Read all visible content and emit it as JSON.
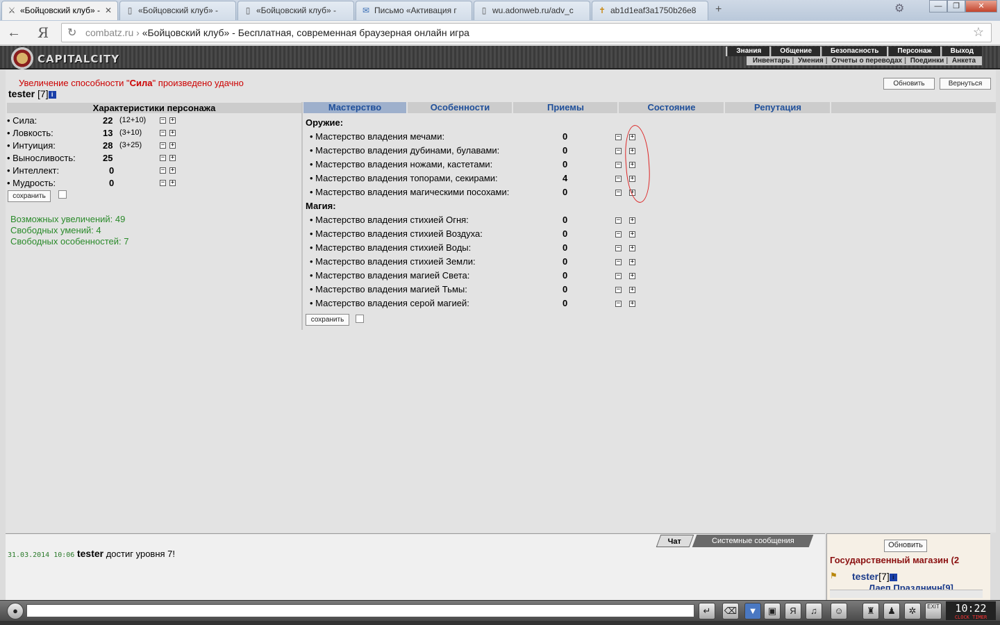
{
  "browser": {
    "tabs": [
      {
        "title": "«Бойцовский клуб» -",
        "icon": "crossed-swords-icon",
        "active": true
      },
      {
        "title": "«Бойцовский клуб» -",
        "icon": "page-icon"
      },
      {
        "title": "«Бойцовский клуб» -",
        "icon": "page-icon"
      },
      {
        "title": "Письмо «Активация г",
        "icon": "mail-icon"
      },
      {
        "title": "wu.adonweb.ru/adv_c",
        "icon": "page-icon"
      },
      {
        "title": "ab1d1eaf3a1750b26e8",
        "icon": "cross-icon"
      }
    ],
    "new_tab": "+",
    "window_buttons": {
      "minimize": "—",
      "maximize": "❐",
      "close": "✕"
    },
    "url_host": "combatz.ru",
    "url_sep": "›",
    "url_title": "«Бойцовский клуб» - Бесплатная, современная браузерная онлайн игра",
    "yandex_label": "Я"
  },
  "game": {
    "logo_text": "CAPITALCITY",
    "menu_top": [
      "Знания",
      "Общение",
      "Безопасность",
      "Персонаж",
      "Выход"
    ],
    "menu_bottom": [
      "Инвентарь",
      "Умения",
      "Отчеты о переводах",
      "Поединки",
      "Анкета"
    ],
    "notice_pre": "Увеличение способности \"",
    "notice_stat": "Сила",
    "notice_post": "\" произведено удачно",
    "char_name": "tester",
    "char_level": "[7]",
    "info_glyph": "i",
    "refresh_label": "Обновить",
    "back_label": "Вернуться",
    "stats_header": "Характеристики персонажа",
    "stats": [
      {
        "name": "• Сила:",
        "value": "22",
        "bonus": "(12+10)"
      },
      {
        "name": "• Ловкость:",
        "value": "13",
        "bonus": "(3+10)"
      },
      {
        "name": "• Интуиция:",
        "value": "28",
        "bonus": "(3+25)"
      },
      {
        "name": "• Выносливость:",
        "value": "25",
        "bonus": ""
      },
      {
        "name": "• Интеллект:",
        "value": "0",
        "bonus": ""
      },
      {
        "name": "• Мудрость:",
        "value": "0",
        "bonus": ""
      }
    ],
    "save_label": "сохранить",
    "possible_increases": "Возможных увеличений: 49",
    "free_skills": "Свободных умений: 4",
    "free_features": "Свободных особенностей: 7",
    "tabs": [
      "Мастерство",
      "Особенности",
      "Приемы",
      "Состояние",
      "Репутация"
    ],
    "weapons_header": "Оружие:",
    "weapons": [
      {
        "name": "• Мастерство владения мечами:",
        "value": "0"
      },
      {
        "name": "• Мастерство владения дубинами, булавами:",
        "value": "0"
      },
      {
        "name": "• Мастерство владения ножами, кастетами:",
        "value": "0"
      },
      {
        "name": "• Мастерство владения топорами, секирами:",
        "value": "4"
      },
      {
        "name": "• Мастерство владения магическими посохами:",
        "value": "0"
      }
    ],
    "magic_header": "Магия:",
    "magic": [
      {
        "name": "• Мастерство владения стихией Огня:",
        "value": "0"
      },
      {
        "name": "• Мастерство владения стихией Воздуха:",
        "value": "0"
      },
      {
        "name": "• Мастерство владения стихией Воды:",
        "value": "0"
      },
      {
        "name": "• Мастерство владения стихией Земли:",
        "value": "0"
      },
      {
        "name": "• Мастерство владения магией Света:",
        "value": "0"
      },
      {
        "name": "• Мастерство владения магией Тьмы:",
        "value": "0"
      },
      {
        "name": "• Мастерство владения серой магией:",
        "value": "0"
      }
    ],
    "minus_glyph": "−",
    "plus_glyph": "+"
  },
  "chat": {
    "tab_chat": "Чат",
    "tab_system": "Системные сообщения",
    "message_time": "31.03.2014 10:06",
    "message_user": "tester",
    "message_text": "достиг уровня 7!",
    "refresh_label": "Обновить",
    "shop_title": "Государственный магазин (2",
    "online_user": "tester",
    "online_level": "[7]",
    "online_user2": "Лаеп Праздничн[9]"
  },
  "bottom": {
    "clock_time": "10:22",
    "clock_labels": "CLOCK TIMER",
    "exit_label": "EXIT"
  }
}
